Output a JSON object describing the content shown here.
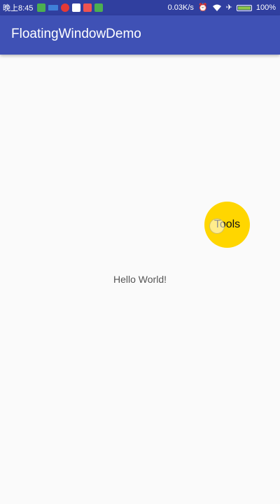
{
  "status_bar": {
    "time": "晚上8:45",
    "speed": "0.03K/s",
    "battery_percent": "100%",
    "battery_level": 1.0,
    "icons": [
      "notification-green-icon",
      "notification-blue-icon",
      "notification-red-icon",
      "notification-white-icon",
      "notification-redsq-icon",
      "notification-green2-icon"
    ],
    "right_icons": [
      "alarm-icon",
      "wifi-icon",
      "airplane-icon",
      "battery-icon"
    ]
  },
  "app_bar": {
    "title": "FloatingWindowDemo",
    "color": "#3f51b5"
  },
  "main": {
    "hello_text": "Hello World!"
  },
  "floating_window": {
    "label": "Tools",
    "color": "#ffd600"
  }
}
